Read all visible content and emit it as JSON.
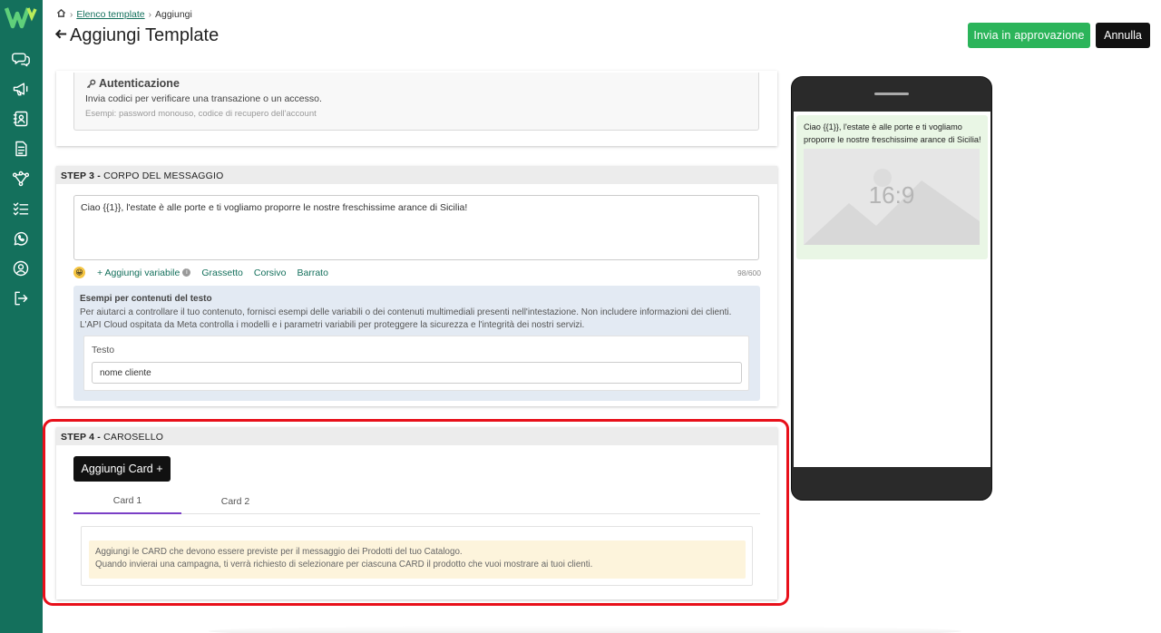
{
  "breadcrumb": {
    "link": "Elenco template",
    "current": "Aggiungi"
  },
  "header": {
    "title": "Aggiungi Template",
    "approve_label": "Invia in approvazione",
    "cancel_label": "Annulla"
  },
  "auth": {
    "title": "Autenticazione",
    "description": "Invia codici per verificare una transazione o un accesso.",
    "examples": "Esempi: password monouso, codice di recupero dell'account"
  },
  "step3": {
    "step": "STEP 3 -",
    "title": "CORPO DEL MESSAGGIO",
    "body_text": "Ciao {{1}}, l'estate è alle porte e ti vogliamo proporre le nostre freschissime arance di Sicilia!",
    "emoji": "😀",
    "add_variable": "+ Aggiungi variabile",
    "info": "i",
    "bold": "Grassetto",
    "italic": "Corsivo",
    "strike": "Barrato",
    "counter": "98/600",
    "examples_title": "Esempi per contenuti del testo",
    "examples_desc": "Per aiutarci a controllare il tuo contenuto, fornisci esempi delle variabili o dei contenuti multimediali presenti nell'intestazione. Non includere informazioni dei clienti. L'API Cloud ospitata da Meta controlla i modelli e i parametri variabili per proteggere la sicurezza e l'integrità dei nostri servizi.",
    "field_label": "Testo",
    "field_value": "nome cliente"
  },
  "step4": {
    "step": "STEP 4 -",
    "title": "CAROSELLO",
    "add_card": "Aggiungi Card +",
    "tabs": [
      {
        "label": "Card 1",
        "active": true
      },
      {
        "label": "Card 2",
        "active": false
      }
    ],
    "note_line1": "Aggiungi le CARD che devono essere previste per il messaggio dei Prodotti del tuo Catalogo.",
    "note_line2": "Quando invierai una campagna, ti verrà richiesto di selezionare per ciascuna CARD il prodotto che vuoi mostrare ai tuoi clienti."
  },
  "preview": {
    "message": "Ciao {{1}}, l'estate è alle porte e ti vogliamo proporre le nostre freschissime arance di Sicilia!",
    "media_ratio": "16:9"
  },
  "sidebar": {
    "icons": [
      "chat-icon",
      "megaphone-icon",
      "contacts-icon",
      "document-icon",
      "flow-icon",
      "checklist-icon",
      "whatsapp-icon",
      "user-circle-icon",
      "logout-icon"
    ]
  },
  "colors": {
    "sidebar": "#14705c",
    "approve": "#2bb45a",
    "highlight": "#e8101a",
    "tab_active": "#7a3fc6",
    "preview_bubble": "#e9f6e5"
  }
}
